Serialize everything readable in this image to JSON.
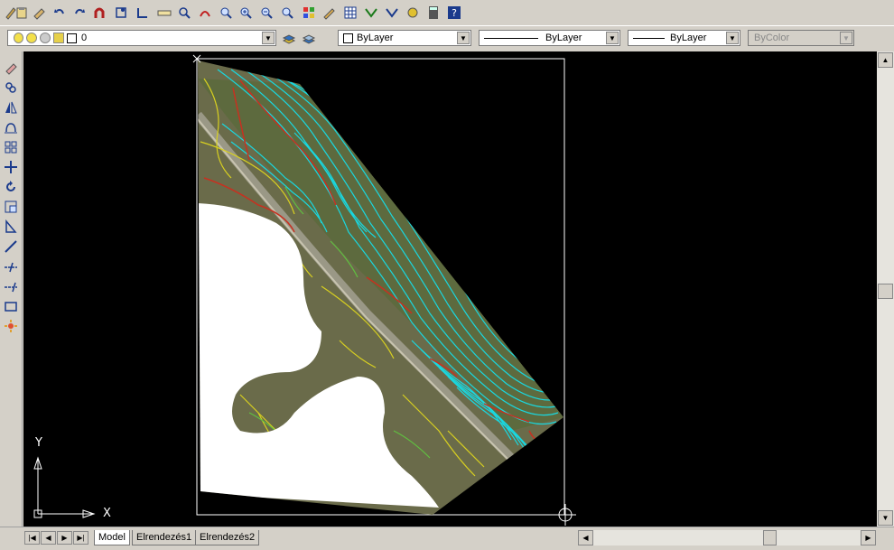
{
  "toolbar_top": {
    "icons": [
      "matchprop-icon",
      "paste-icon",
      "brush-icon",
      "undo-icon",
      "redo-icon",
      "magnet-icon",
      "zoom-extents-icon",
      "box-icon",
      "ruler-icon",
      "bars-icon",
      "pan-icon",
      "zoom-window-icon",
      "zoom-in-icon",
      "zoom-out-icon",
      "zoom-prev-icon",
      "sheet-icon",
      "pencil-icon",
      "table-icon",
      "check-icon",
      "check2-icon",
      "gradient-icon",
      "calculator-icon",
      "help-icon"
    ]
  },
  "properties": {
    "layer_name": "0",
    "color": "ByLayer",
    "linetype": "ByLayer",
    "lineweight": "ByLayer",
    "plotstyle": "ByColor"
  },
  "ucs": {
    "x_label": "X",
    "y_label": "Y"
  },
  "tabs": {
    "model": "Model",
    "layout1": "Elrendezés1",
    "layout2": "Elrendezés2"
  }
}
